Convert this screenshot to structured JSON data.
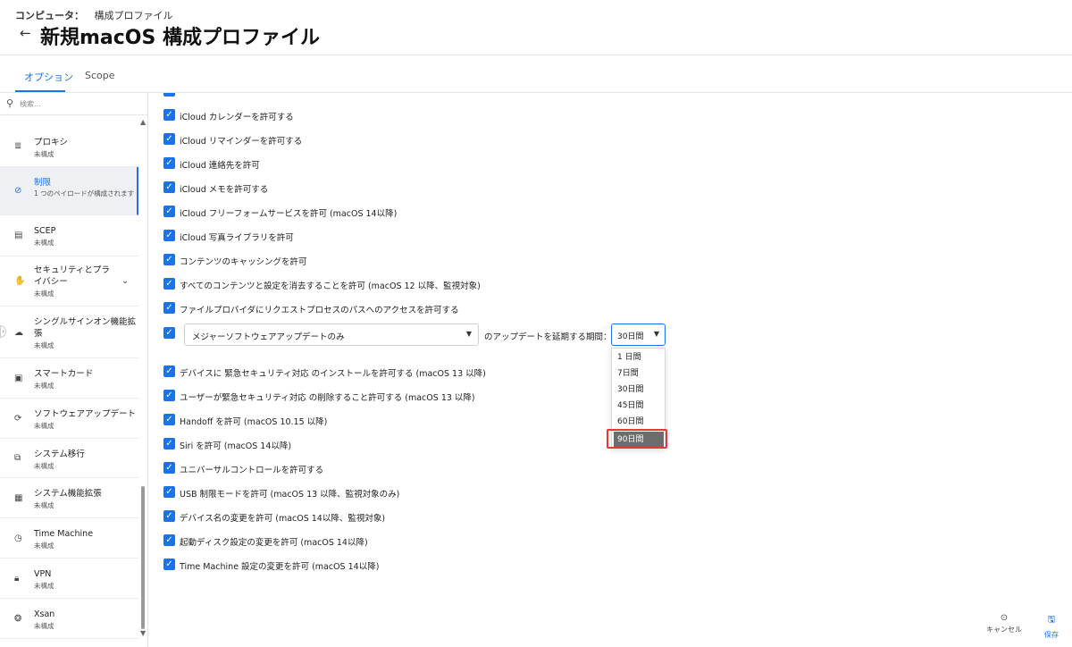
{
  "header": {
    "breadcrumb_root": "コンピュータ：",
    "breadcrumb_current": "構成プロファイル",
    "title": "新規macOS 構成プロファイル"
  },
  "tabs": [
    {
      "label": "オプション"
    },
    {
      "label": "Scope"
    }
  ],
  "sidebar": {
    "search_placeholder": "検索...",
    "items": [
      {
        "label": "プロキシ",
        "sub": "未構成"
      },
      {
        "label": "制限",
        "sub": "1 つのペイロードが構成されます"
      },
      {
        "label": "SCEP",
        "sub": "未構成"
      },
      {
        "label1": "セキュリティとプラ",
        "label2": "イバシー",
        "sub": "未構成"
      },
      {
        "label1": "シングルサインオン機能拡",
        "label2": "張",
        "sub": "未構成"
      },
      {
        "label": "スマートカード",
        "sub": "未構成"
      },
      {
        "label": "ソフトウェアアップデート",
        "sub": "未構成"
      },
      {
        "label": "システム移行",
        "sub": "未構成"
      },
      {
        "label": "システム機能拡張",
        "sub": "未構成"
      },
      {
        "label": "Time Machine",
        "sub": "未構成"
      },
      {
        "label": "VPN",
        "sub": "未構成"
      },
      {
        "label": "Xsan",
        "sub": "未構成"
      }
    ]
  },
  "options": [
    "iCloud カレンダーを許可する",
    "iCloud リマインダーを許可する",
    "iCloud 連絡先を許可",
    "iCloud メモを許可する",
    "iCloud フリーフォームサービスを許可 (macOS 14以降)",
    "iCloud 写真ライブラリを許可",
    "コンテンツのキャッシングを許可",
    "すべてのコンテンツと設定を消去することを許可 (macOS 12 以降、監視対象)",
    "ファイルプロバイダにリクエストプロセスのパスへのアクセスを許可する"
  ],
  "defer": {
    "update_type": "メジャーソフトウェアアップデートのみ",
    "middle_text": "のアップデートを延期する期間：",
    "period_value": "30日間",
    "period_options": [
      "1 日間",
      "7日間",
      "30日間",
      "45日間",
      "60日間",
      "90日間"
    ]
  },
  "options2": [
    "デバイスに 緊急セキュリティ対応 のインストールを許可する (macOS 13 以降)",
    "ユーザーが緊急セキュリティ対応 の削除すること許可する (macOS 13 以降)",
    "Handoff を許可 (macOS 10.15 以降)",
    "Siri を許可 (macOS 14以降)",
    "ユニバーサルコントロールを許可する",
    "USB 制限モードを許可 (macOS 13 以降、監視対象のみ)",
    "デバイス名の変更を許可 (macOS 14以降、監視対象)",
    "起動ディスク設定の変更を許可 (macOS 14以降)",
    "Time Machine 設定の変更を許可 (macOS 14以降)"
  ],
  "footer": {
    "cancel_label": "キャンセル",
    "save_label": "保存"
  },
  "colors": {
    "accent": "#1a73e8",
    "highlight": "#e53935"
  }
}
